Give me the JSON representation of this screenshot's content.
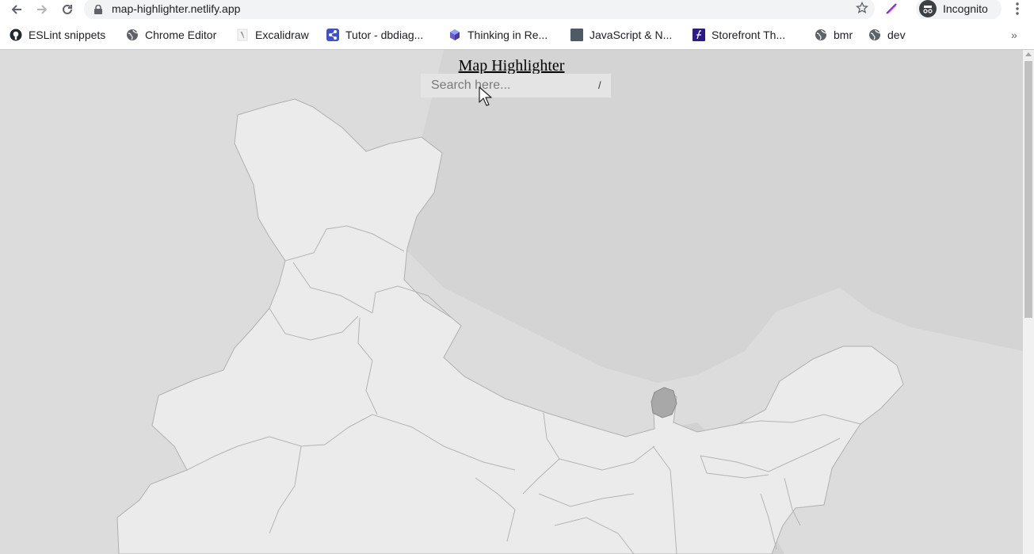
{
  "browser": {
    "url": "map-highlighter.netlify.app",
    "profile_label": "Incognito",
    "icons": [
      "back-icon",
      "forward-icon",
      "reload-icon",
      "lock-icon",
      "star-icon",
      "extension-icon",
      "incognito-icon",
      "menu-icon"
    ]
  },
  "bookmarks": {
    "items": [
      {
        "label": "ESLint snippets",
        "icon": "github-icon"
      },
      {
        "label": "Chrome Editor",
        "icon": "globe-icon"
      },
      {
        "label": "Excalidraw",
        "icon": "excalidraw-icon"
      },
      {
        "label": "Tutor - dbdiag...",
        "icon": "dbdiagram-icon"
      },
      {
        "label": "Thinking in Re...",
        "icon": "react-cube-icon"
      },
      {
        "label": "JavaScript & N...",
        "icon": "square-icon"
      },
      {
        "label": "Storefront Th...",
        "icon": "storefront-icon"
      },
      {
        "label": "bmr",
        "icon": "globe-icon"
      },
      {
        "label": "dev",
        "icon": "globe-icon"
      }
    ],
    "overflow_label": "»"
  },
  "page": {
    "title": "Map Highlighter",
    "search": {
      "placeholder": "Search here...",
      "shortcut_hint": "/"
    }
  },
  "colors": {
    "map_background": "#dcdcdc",
    "state_fill": "#ebebeb",
    "state_stroke": "#b0b0b0",
    "neighbor_fill": "#d2d2d2",
    "highlighted_state": "#a8a8a8"
  }
}
